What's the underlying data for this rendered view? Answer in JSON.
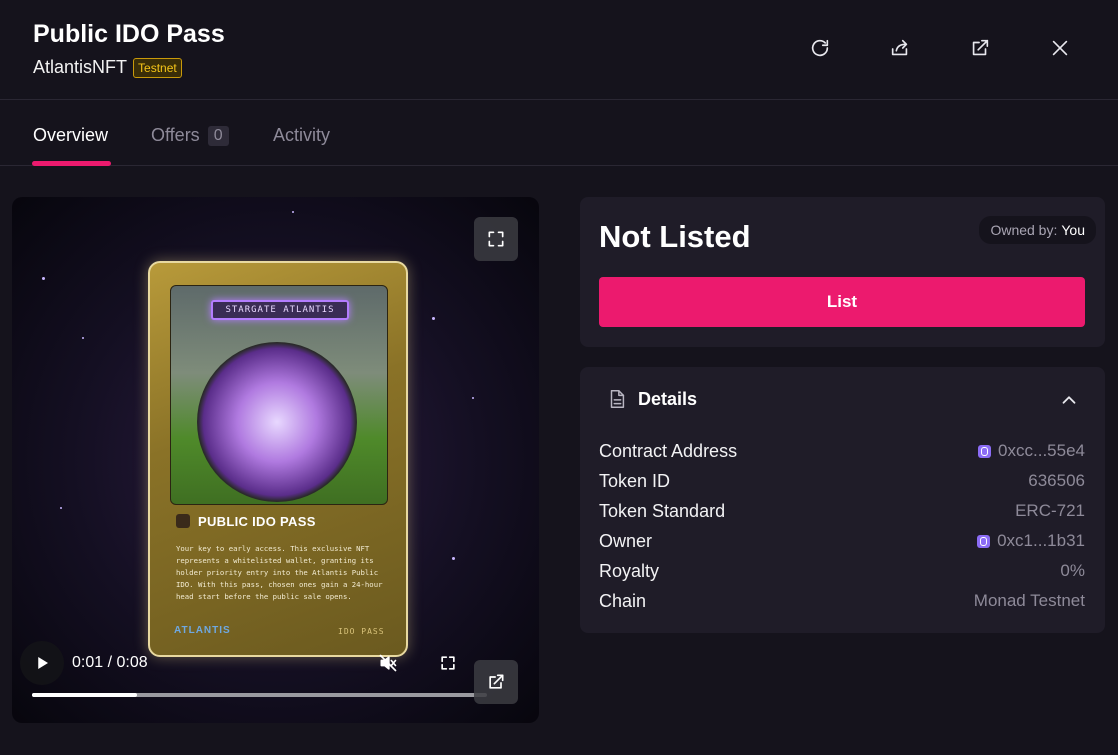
{
  "header": {
    "title": "Public IDO Pass",
    "collection": "AtlantisNFT",
    "network_badge": "Testnet",
    "actions": [
      {
        "name": "refresh-icon"
      },
      {
        "name": "share-icon"
      },
      {
        "name": "external-link-icon"
      },
      {
        "name": "close-icon"
      }
    ]
  },
  "tabs": [
    {
      "label": "Overview",
      "active": true
    },
    {
      "label": "Offers",
      "count": "0"
    },
    {
      "label": "Activity"
    }
  ],
  "media": {
    "card": {
      "banner": "STARGATE ATLANTIS",
      "heading": "PUBLIC IDO PASS",
      "description": "Your key to early access. This exclusive NFT represents a whitelisted wallet, granting its holder priority entry into the Atlantis Public IDO. With this pass, chosen ones gain a 24-hour head start before the public sale opens.",
      "footer_left": "ATLANTIS",
      "footer_right": "IDO PASS"
    },
    "player": {
      "time": "0:01 / 0:08",
      "progress": 0.23
    }
  },
  "listing": {
    "status": "Not Listed",
    "owned_label": "Owned by:",
    "owner": "You",
    "list_button": "List"
  },
  "details": {
    "title": "Details",
    "rows": [
      {
        "label": "Contract Address",
        "value": "0xcc...55e4",
        "icon": "monad-icon"
      },
      {
        "label": "Token ID",
        "value": "636506"
      },
      {
        "label": "Token Standard",
        "value": "ERC-721"
      },
      {
        "label": "Owner",
        "value": "0xc1...1b31",
        "icon": "monad-icon"
      },
      {
        "label": "Royalty",
        "value": "0%"
      },
      {
        "label": "Chain",
        "value": "Monad Testnet"
      }
    ]
  },
  "colors": {
    "accent": "#ec1a6e",
    "background": "#15131c",
    "panel": "#1f1c28",
    "badge": "#f5c518"
  }
}
